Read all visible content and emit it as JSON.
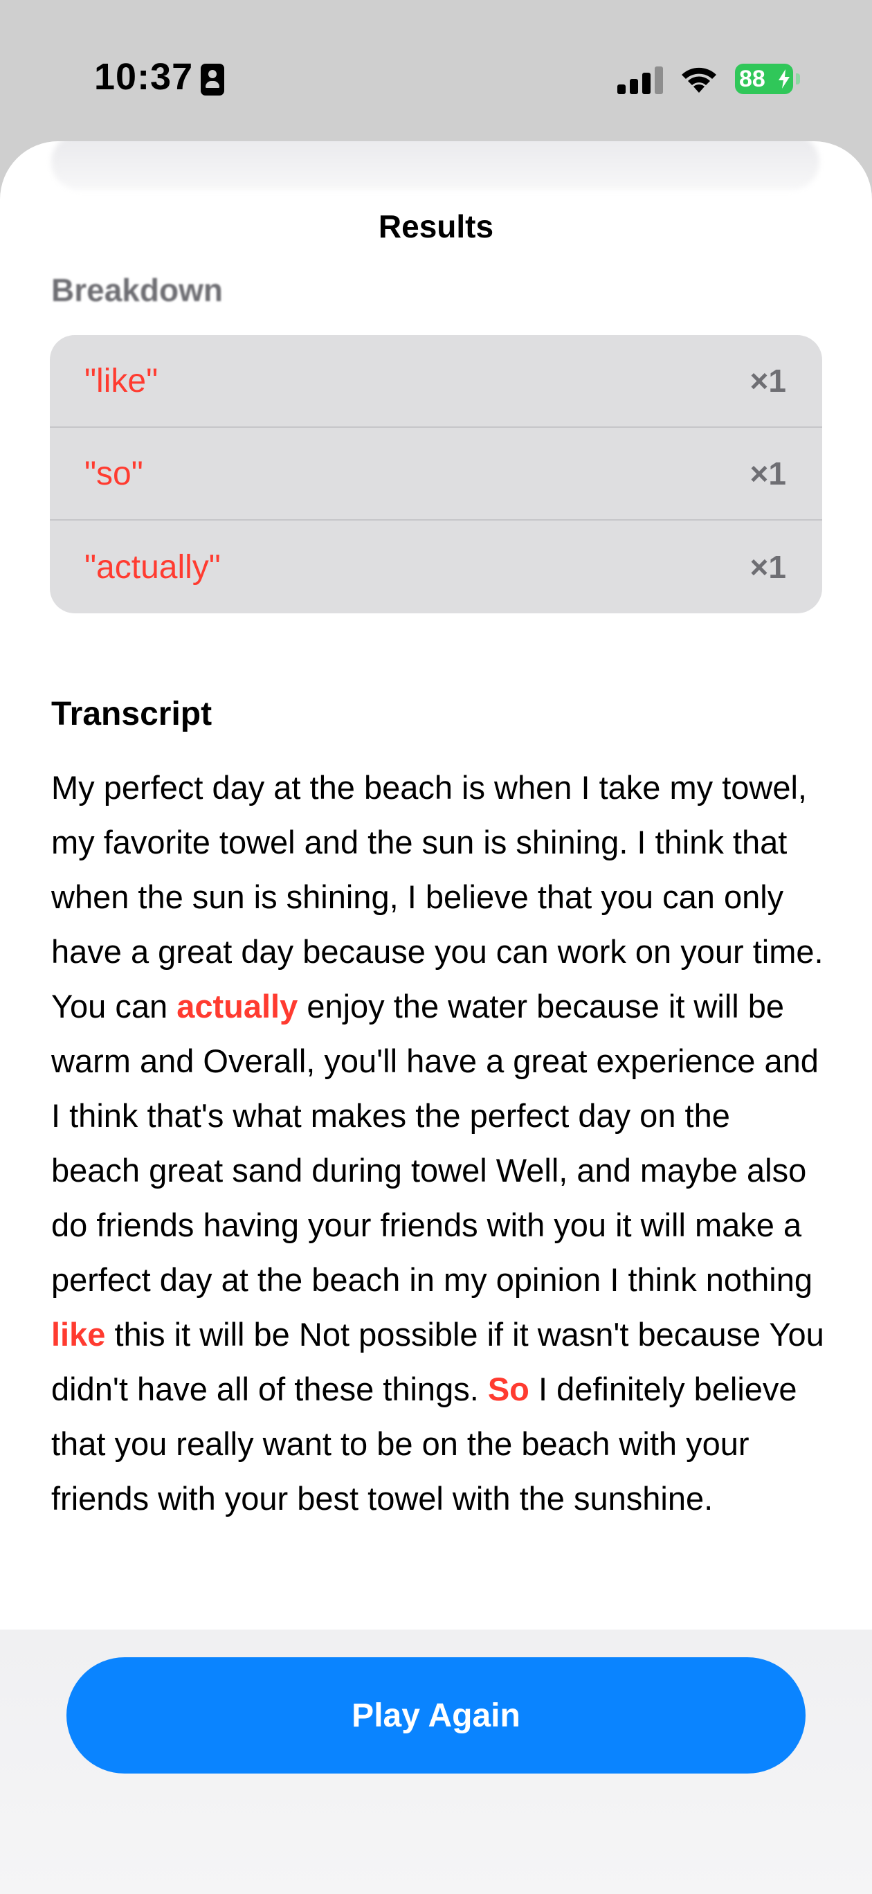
{
  "status_bar": {
    "time": "10:37",
    "battery": "88"
  },
  "sheet": {
    "title": "Results",
    "blurred_text": "Breakdown"
  },
  "breakdown": {
    "items": [
      {
        "word": "\"like\"",
        "count": "×1"
      },
      {
        "word": "\"so\"",
        "count": "×1"
      },
      {
        "word": "\"actually\"",
        "count": "×1"
      }
    ]
  },
  "transcript": {
    "heading": "Transcript",
    "segments": [
      {
        "text": "My perfect day at the beach is when I take my towel, my favorite towel and the sun is shining. I think that when the sun is shining, I believe that you can only have a great day because you can work on your time. You can ",
        "filler": false
      },
      {
        "text": "actually",
        "filler": true
      },
      {
        "text": " enjoy the water because it will be warm and Overall, you'll have a great experience and I think that's what makes the perfect day on the beach great sand during towel Well, and maybe also do friends having your friends with you it will make a perfect day at the beach in my opinion I think nothing ",
        "filler": false
      },
      {
        "text": "like",
        "filler": true
      },
      {
        "text": " this it will be Not possible if it wasn't because You didn't have all of these things. ",
        "filler": false
      },
      {
        "text": "So",
        "filler": true
      },
      {
        "text": " I definitely believe that you really want to be on the beach with your friends with your best towel with the sunshine.",
        "filler": false
      }
    ]
  },
  "actions": {
    "play_again_label": "Play Again"
  },
  "colors": {
    "accent": "#0a84ff",
    "filler": "#ff3b30",
    "battery": "#30c759"
  }
}
